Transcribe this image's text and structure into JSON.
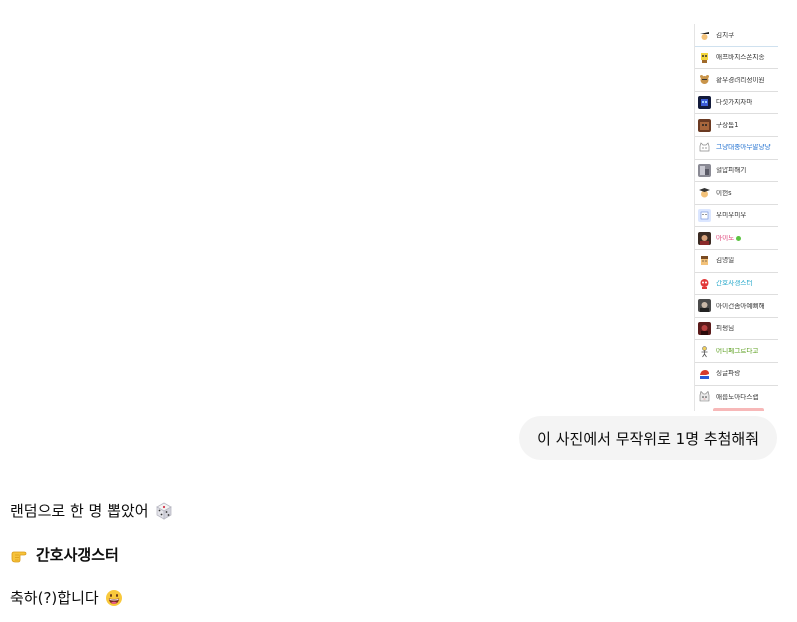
{
  "attachment": {
    "nicknames": [
      {
        "name": "김치쿠",
        "color": "#333333",
        "avatar": "cap-kid-icon"
      },
      {
        "name": "애프바치스폰지송",
        "color": "#333333",
        "avatar": "sponge-icon"
      },
      {
        "name": "황우경려리정이원",
        "color": "#333333",
        "avatar": "bear-icon"
      },
      {
        "name": "다섯가지자마",
        "color": "#333333",
        "avatar": "robot-icon"
      },
      {
        "name": "구상톰1",
        "color": "#333333",
        "avatar": "brown-box-icon"
      },
      {
        "name": "그냥대충아무말냥냥",
        "color": "#1e6fd0",
        "avatar": "cat-sketch-icon"
      },
      {
        "name": "혈압피해기",
        "color": "#333333",
        "avatar": "photo-icon"
      },
      {
        "name": "이헌s",
        "color": "#333333",
        "avatar": "grad-cap-icon"
      },
      {
        "name": "우미우미우",
        "color": "#333333",
        "avatar": "pixel-face-icon"
      },
      {
        "name": "아이도",
        "color": "#e0457b",
        "avatar": "photo-dark-icon",
        "online": true
      },
      {
        "name": "김명일",
        "color": "#333333",
        "avatar": "pixel-man-icon"
      },
      {
        "name": "간호사갱스터",
        "color": "#1fa6c9",
        "avatar": "red-character-icon"
      },
      {
        "name": "아이건좀아예뻐해",
        "color": "#333333",
        "avatar": "photo-gray-icon"
      },
      {
        "name": "피펑님",
        "color": "#333333",
        "avatar": "photo-red-icon"
      },
      {
        "name": "어니페그르다고",
        "color": "#5a9e1c",
        "avatar": "stick-figure-icon"
      },
      {
        "name": "싱글파랑",
        "color": "#333333",
        "avatar": "red-bird-icon"
      },
      {
        "name": "애룹도아다스랩",
        "color": "#333333",
        "avatar": "cat-face-icon"
      }
    ]
  },
  "user_message": {
    "text": "이 사진에서 무작위로 1명 추첨해줘"
  },
  "assistant_message": {
    "line1": "랜덤으로 한 명 뽑았어",
    "line1_emoji": "dice-icon",
    "line2": "간호사갱스터",
    "line2_emoji": "pointing-hand-icon",
    "line3": "축하(?)합니다",
    "line3_emoji": "grinning-face-icon"
  }
}
